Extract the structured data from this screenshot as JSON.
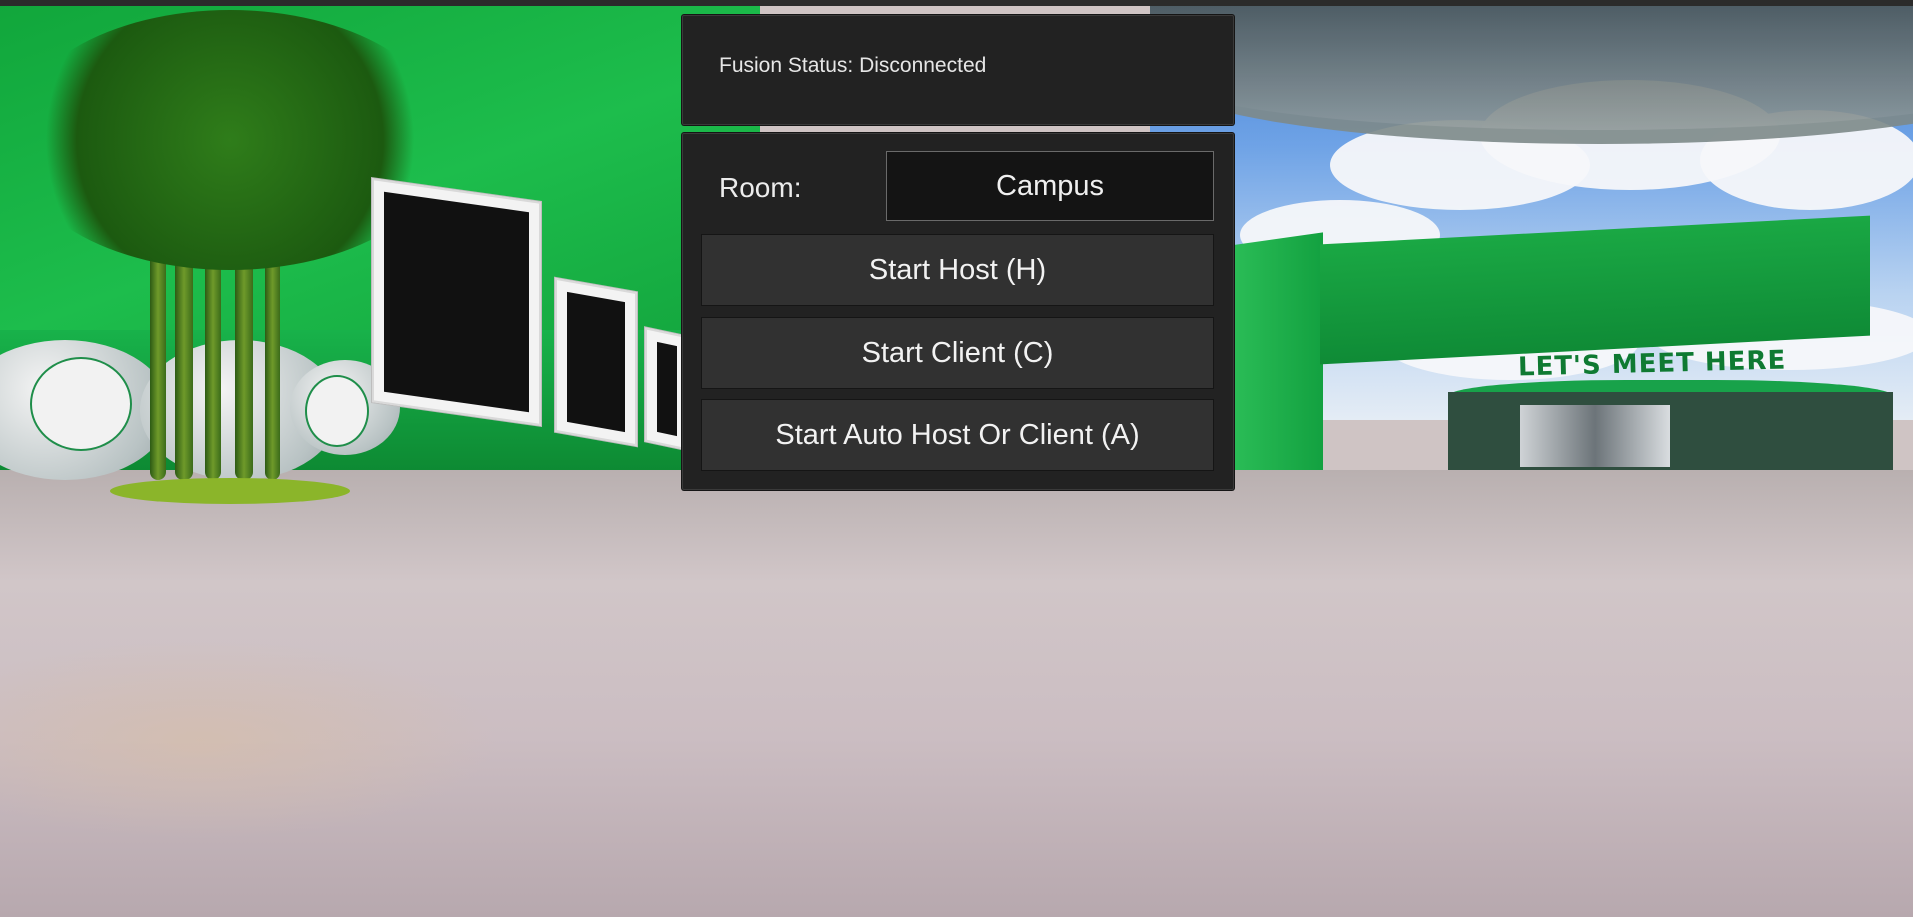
{
  "status": {
    "text": "Fusion Status: Disconnected"
  },
  "room": {
    "label": "Room:",
    "value": "Campus"
  },
  "buttons": {
    "host": "Start Host (H)",
    "client": "Start Client (C)",
    "auto": "Start Auto Host Or Client (A)"
  },
  "scene": {
    "sign_text": "LET'S MEET HERE"
  },
  "colors": {
    "panel_bg": "#222222",
    "button_bg": "#313131",
    "input_bg": "#141414",
    "text": "#f0f0f0",
    "scene_green": "#1dbd4c"
  }
}
